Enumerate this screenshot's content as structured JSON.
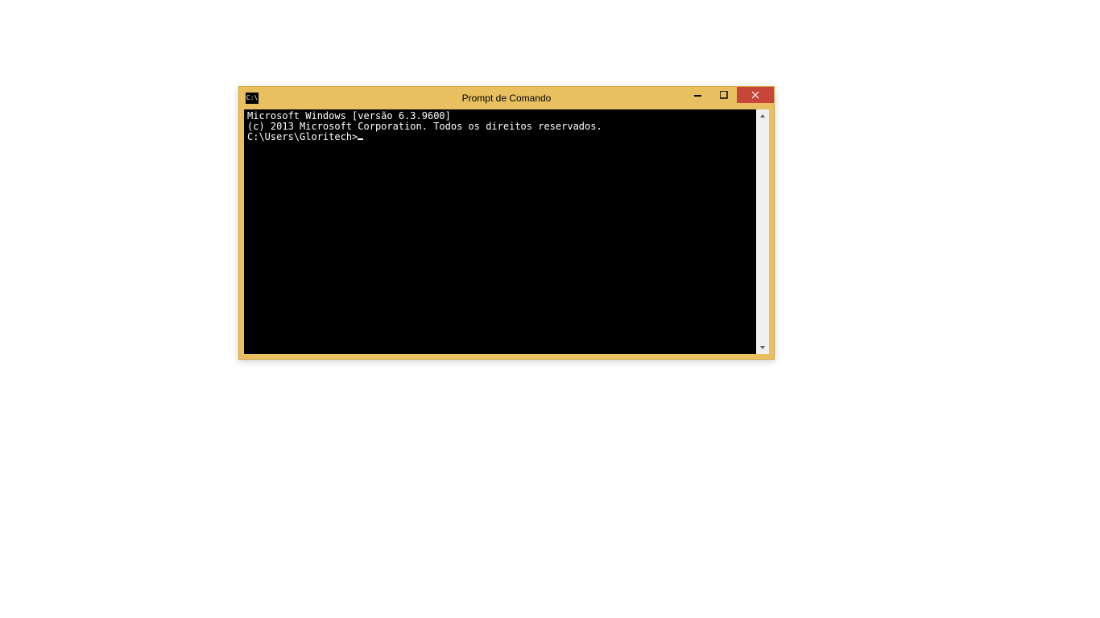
{
  "window": {
    "title": "Prompt de Comando",
    "icon_text": "C:\\"
  },
  "console": {
    "line1": "Microsoft Windows [versão 6.3.9600]",
    "line2": "(c) 2013 Microsoft Corporation. Todos os direitos reservados.",
    "blank": "",
    "prompt": "C:\\Users\\Gloritech>"
  }
}
